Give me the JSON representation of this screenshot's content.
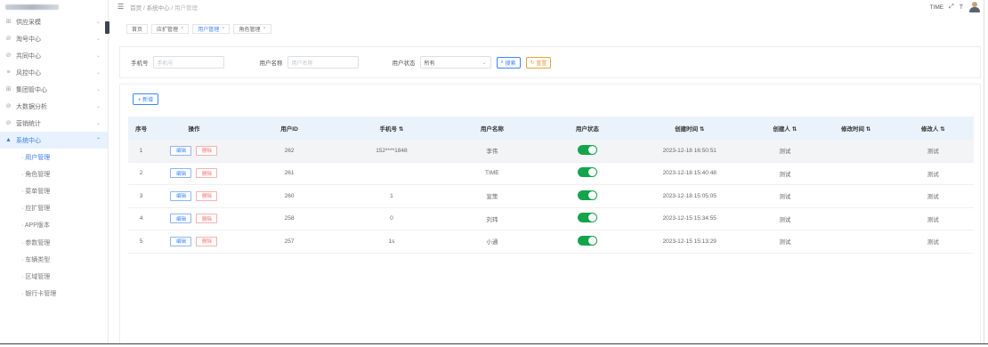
{
  "sidebar": {
    "items": [
      {
        "label": "供应采模",
        "icon": "grid-icon"
      },
      {
        "label": "淘号中心",
        "icon": "phone-icon"
      },
      {
        "label": "共同中心",
        "icon": "user-icon"
      },
      {
        "label": "风控中心",
        "icon": "shield-icon"
      },
      {
        "label": "集团管中心",
        "icon": "building-icon"
      },
      {
        "label": "大数据分析",
        "icon": "chart-icon"
      },
      {
        "label": "营销统计",
        "icon": "stats-icon"
      },
      {
        "label": "系统中心",
        "icon": "settings-icon"
      }
    ],
    "subitems": [
      "· 用户管理",
      "· 角色管理",
      "· 菜单管理",
      "· 应扩管理",
      "· APP版本",
      "· 参数管理",
      "· 车辆类型",
      "· 区域管理",
      "· 银行卡管理"
    ]
  },
  "topbar": {
    "breadcrumb_home": "首页",
    "breadcrumb_mid": "系统中心",
    "breadcrumb_last": "用户管理",
    "right_text": "TIME"
  },
  "tags": [
    {
      "label": "首页",
      "closable": false
    },
    {
      "label": "应扩管理",
      "closable": true
    },
    {
      "label": "用户管理",
      "closable": true
    },
    {
      "label": "角色管理",
      "closable": true
    }
  ],
  "search": {
    "phone_label": "手机号",
    "phone_placeholder": "手机号",
    "name_label": "用户名称",
    "name_placeholder": "用户名称",
    "status_label": "用户状态",
    "status_value": "所有",
    "search_btn": "搜索",
    "reset_btn": "重置"
  },
  "toolbar": {
    "add_label": "+ 新增"
  },
  "table": {
    "headers": [
      "序号",
      "操作",
      "用户ID",
      "手机号 ⇅",
      "用户名称",
      "用户状态",
      "创建时间 ⇅",
      "创建人 ⇅",
      "修改时间 ⇅",
      "修改人 ⇅"
    ],
    "edit_label": "编辑",
    "delete_label": "删除",
    "rows": [
      {
        "idx": "1",
        "id": "262",
        "phone": "152****1848",
        "name": "李伟",
        "status": true,
        "created": "2023-12-18 16:50:51",
        "creator": "测试",
        "modified": "",
        "modifier": "测试"
      },
      {
        "idx": "2",
        "id": "261",
        "phone": "",
        "name": "TIME",
        "status": true,
        "created": "2023-12-18 15:40:48",
        "creator": "测试",
        "modified": "",
        "modifier": "测试"
      },
      {
        "idx": "3",
        "id": "260",
        "phone": "1",
        "name": "宣策",
        "status": true,
        "created": "2023-12-18 15:05:05",
        "creator": "测试",
        "modified": "",
        "modifier": "测试"
      },
      {
        "idx": "4",
        "id": "258",
        "phone": "0",
        "name": "刘玮",
        "status": true,
        "created": "2023-12-15 15:34:55",
        "creator": "测试",
        "modified": "",
        "modifier": "测试"
      },
      {
        "idx": "5",
        "id": "257",
        "phone": "1s",
        "name": "小通",
        "status": true,
        "created": "2023-12-15 15:13:29",
        "creator": "测试",
        "modified": "",
        "modifier": "测试"
      }
    ]
  },
  "colors": {
    "primary": "#3a86ff",
    "danger": "#f56c6c",
    "switch_on": "#13a44c",
    "header_bg": "#eaf3fc",
    "active_menu_bg": "#e8f2ff"
  }
}
